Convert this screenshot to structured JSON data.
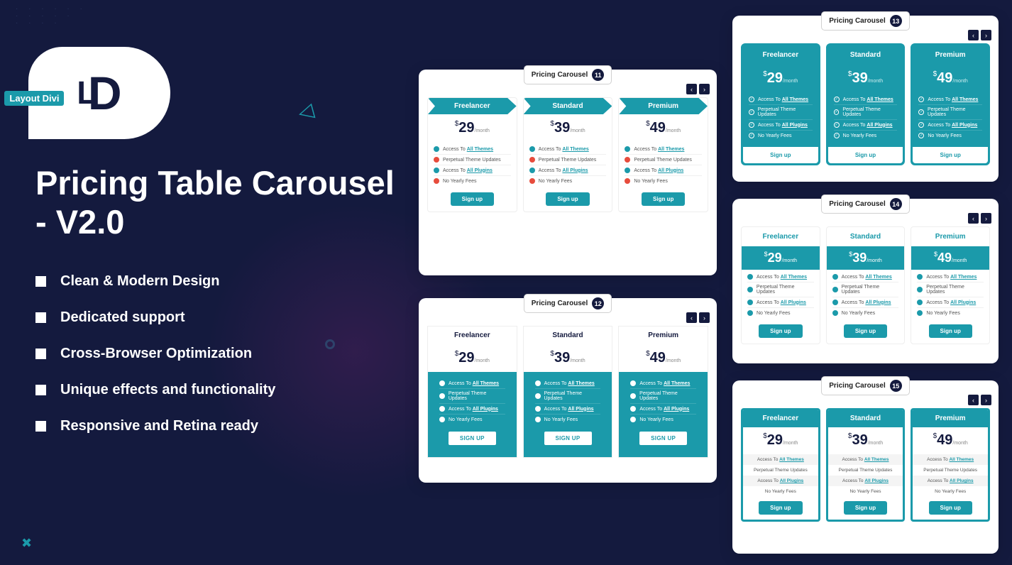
{
  "logo_text": "Layout Divi",
  "main_title": "Pricing Table Carousel - V2.0",
  "features": [
    "Clean & Modern Design",
    "Dedicated support",
    "Cross-Browser Optimization",
    "Unique effects and functionality",
    "Responsive and Retina ready"
  ],
  "panel_label": "Pricing Carousel",
  "panel_numbers": {
    "p11": "11",
    "p12": "12",
    "p13": "13",
    "p14": "14",
    "p15": "15"
  },
  "plan_names": [
    "Freelancer",
    "Standard",
    "Premium"
  ],
  "prices": {
    "freelancer": "29",
    "standard": "39",
    "premium": "49"
  },
  "currency": "$",
  "per": "/month",
  "feat": {
    "themes_prefix": "Access To ",
    "themes_link": "All Themes",
    "updates": "Perpetual Theme Updates",
    "plugins_prefix": "Access To ",
    "plugins_link": "All Plugins",
    "yearly": "No Yearly Fees"
  },
  "signup": "Sign up",
  "signup_upper": "SIGN UP"
}
